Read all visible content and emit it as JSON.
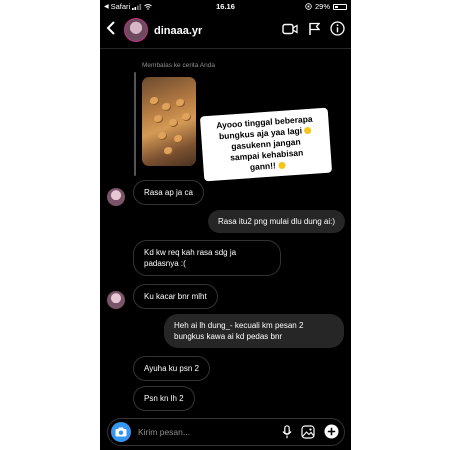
{
  "status_bar": {
    "carrier": "Safari",
    "time": "16.16",
    "battery": "29%",
    "battery_level": 0.29
  },
  "header": {
    "username": "dinaaa.yr"
  },
  "story_reply": {
    "note": "Membalas ke cerita Anda",
    "sticker_lines": [
      "Ayooo tinggal beberapa",
      "bungkus aja yaa lagi",
      "gasukenn jangan",
      "sampai kehabisan",
      "gann!!"
    ]
  },
  "messages": [
    {
      "side": "in",
      "text": "Rasa ap ja ca",
      "avatar": true
    },
    {
      "side": "out",
      "text": "Rasa itu2 png mulai dlu dung ai:)"
    },
    {
      "side": "in",
      "text": "Kd kw req kah rasa sdg ja padasnya :(",
      "avatar": false
    },
    {
      "side": "in",
      "text": "Ku kacar bnr mlht",
      "avatar": true
    },
    {
      "side": "out",
      "text": "Heh ai lh dung_- kecuali km pesan 2 bungkus kawa ai kd pedas bnr"
    },
    {
      "side": "in",
      "text": "Ayuha ku psn 2",
      "avatar": false
    },
    {
      "side": "in",
      "text": "Psn kn lh 2",
      "avatar": false
    }
  ],
  "composer": {
    "placeholder": "Kirim pesan..."
  },
  "icons": {
    "header": [
      "back-arrow-icon",
      "video-call-icon",
      "flag-icon",
      "info-icon"
    ],
    "composer": [
      "camera-icon",
      "microphone-icon",
      "gallery-icon",
      "plus-icon"
    ]
  },
  "colors": {
    "background": "#000000",
    "outgoing_bubble": "#262626",
    "camera_button": "#3797f0",
    "secondary_text": "#8e8e8e"
  }
}
